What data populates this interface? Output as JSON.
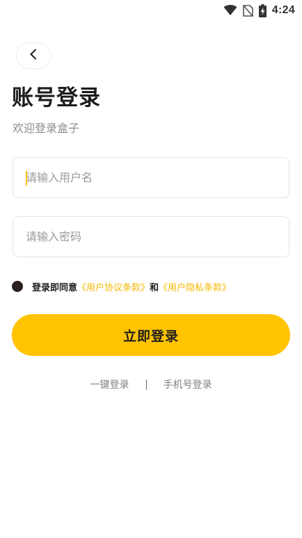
{
  "status_bar": {
    "time": "4:24",
    "icons": [
      "wifi-icon",
      "no-sim-icon",
      "battery-charging-icon"
    ]
  },
  "nav": {
    "back_icon": "chevron-left-icon"
  },
  "header": {
    "title": "账号登录",
    "subtitle": "欢迎登录盒子"
  },
  "form": {
    "username_placeholder": "请输入用户名",
    "password_placeholder": "请输入密码"
  },
  "agreement": {
    "prefix": "登录即同意",
    "user_agreement": "《用户协议条款》",
    "conjunction": "和",
    "privacy_policy": "《用户隐私条款》"
  },
  "login_button": {
    "label": "立即登录"
  },
  "alt_login": {
    "one_click": "一键登录",
    "divider": "|",
    "phone": "手机号登录"
  },
  "colors": {
    "accent": "#ffc300",
    "link": "#f5b800",
    "text_primary": "#1c1c1c",
    "text_secondary": "#8c8c8c",
    "border": "#e3e3e3"
  }
}
